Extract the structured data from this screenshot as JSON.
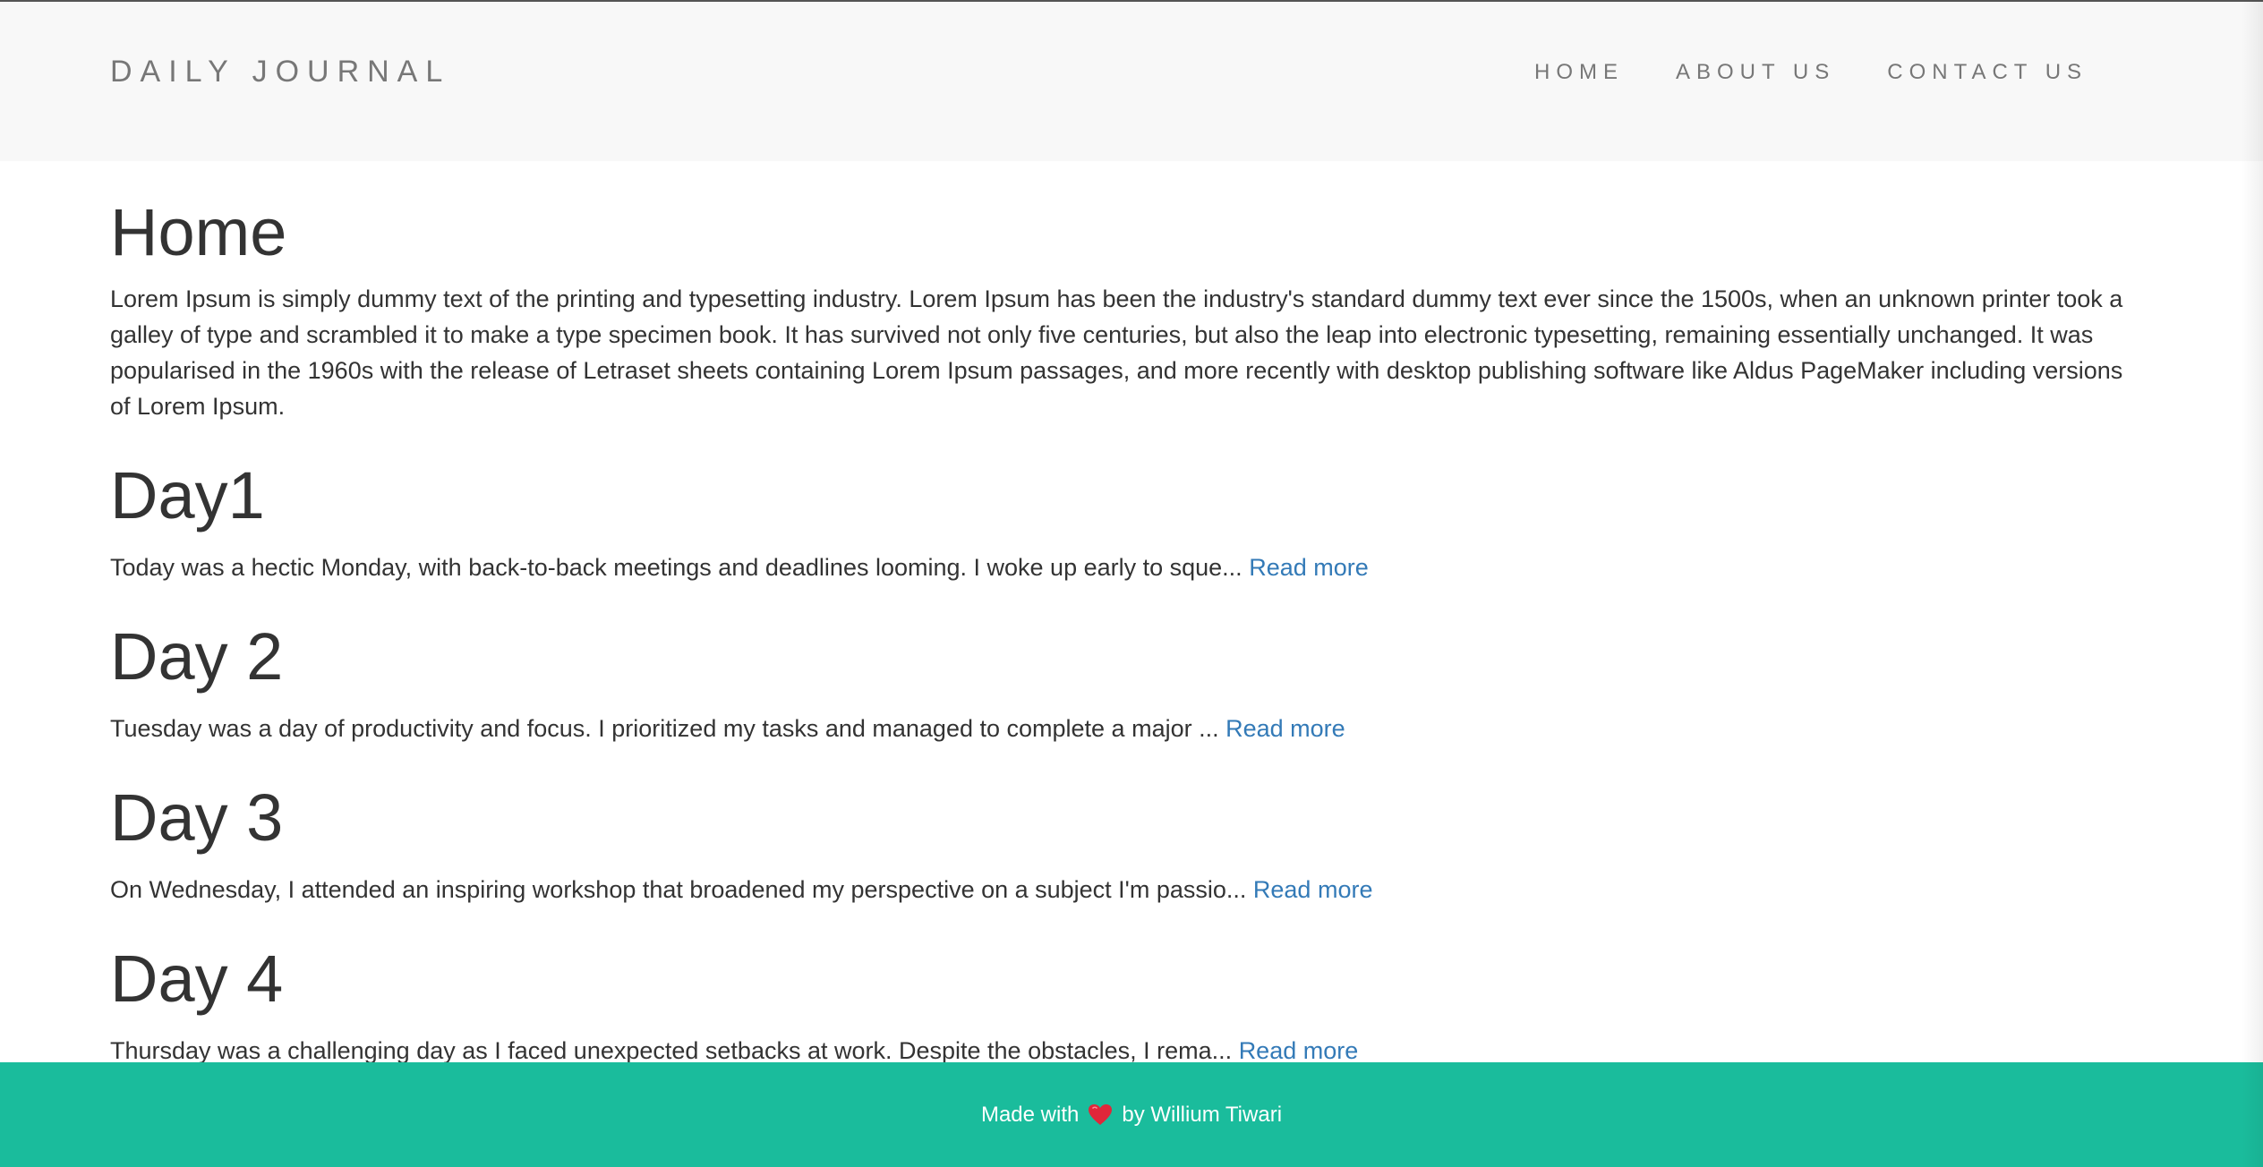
{
  "brand": "DAILY JOURNAL",
  "nav": {
    "home": "HOME",
    "about": "ABOUT US",
    "contact": "CONTACT US"
  },
  "home": {
    "title": "Home",
    "intro": "Lorem Ipsum is simply dummy text of the printing and typesetting industry. Lorem Ipsum has been the industry's standard dummy text ever since the 1500s, when an unknown printer took a galley of type and scrambled it to make a type specimen book. It has survived not only five centuries, but also the leap into electronic typesetting, remaining essentially unchanged. It was popularised in the 1960s with the release of Letraset sheets containing Lorem Ipsum passages, and more recently with desktop publishing software like Aldus PageMaker including versions of Lorem Ipsum."
  },
  "posts": [
    {
      "title": "Day1",
      "excerpt": "Today was a hectic Monday, with back-to-back meetings and deadlines looming. I woke up early to sque...",
      "link": "Read more"
    },
    {
      "title": "Day 2",
      "excerpt": "Tuesday was a day of productivity and focus. I prioritized my tasks and managed to complete a major ...",
      "link": "Read more"
    },
    {
      "title": "Day 3",
      "excerpt": "On Wednesday, I attended an inspiring workshop that broadened my perspective on a subject I'm passio...",
      "link": "Read more"
    },
    {
      "title": "Day 4",
      "excerpt": "Thursday was a challenging day as I faced unexpected setbacks at work. Despite the obstacles, I rema...",
      "link": "Read more"
    }
  ],
  "footer": {
    "made_with": "Made with",
    "icon": "heart-icon",
    "by": "by Willium Tiwari"
  },
  "colors": {
    "navbar_bg": "#f8f8f8",
    "footer_bg": "#1abc9c",
    "link": "#337ab7",
    "heart": "#e0263a"
  }
}
